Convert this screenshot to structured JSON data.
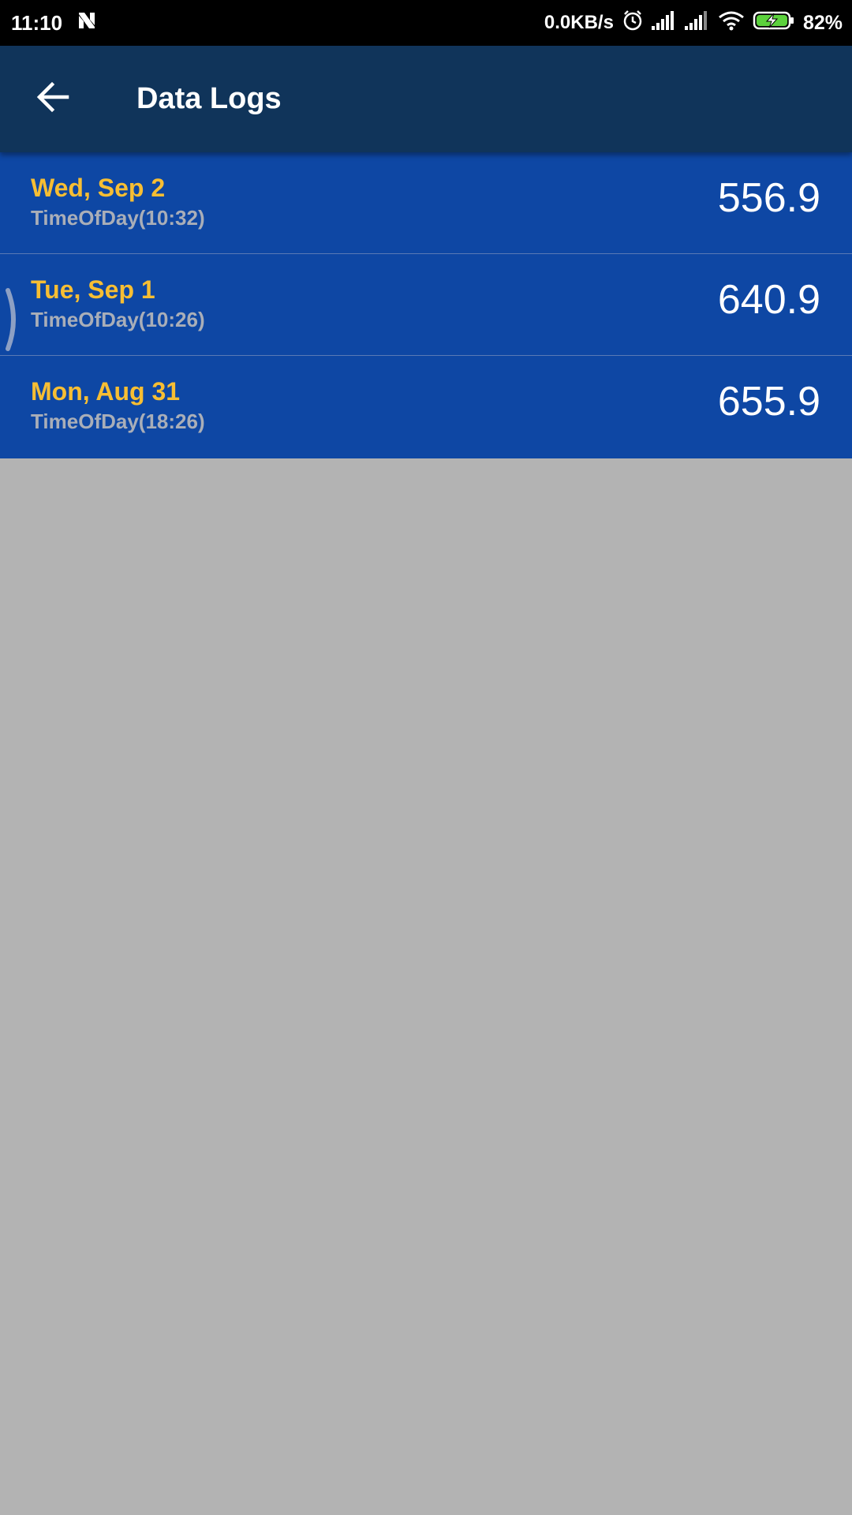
{
  "status_bar": {
    "time": "11:10",
    "net_speed": "0.0KB/s",
    "battery_percent": "82%",
    "icons": [
      "n-notification-icon",
      "alarm-icon",
      "signal-icon",
      "signal-icon",
      "wifi-icon",
      "battery-charging-icon"
    ]
  },
  "app_bar": {
    "title": "Data Logs",
    "back_icon": "arrow-left-icon"
  },
  "logs": [
    {
      "date": "Wed, Sep 2",
      "time": "TimeOfDay(10:32)",
      "value": "556.9"
    },
    {
      "date": "Tue, Sep 1",
      "time": "TimeOfDay(10:26)",
      "value": "640.9"
    },
    {
      "date": "Mon, Aug 31",
      "time": "TimeOfDay(18:26)",
      "value": "655.9"
    }
  ],
  "colors": {
    "status_bar_bg": "#000000",
    "app_bar_bg": "#10345a",
    "row_bg": "#0e47a4",
    "date_text": "#f7be33",
    "time_text": "#a9aeb8",
    "page_bg": "#b3b3b3"
  }
}
